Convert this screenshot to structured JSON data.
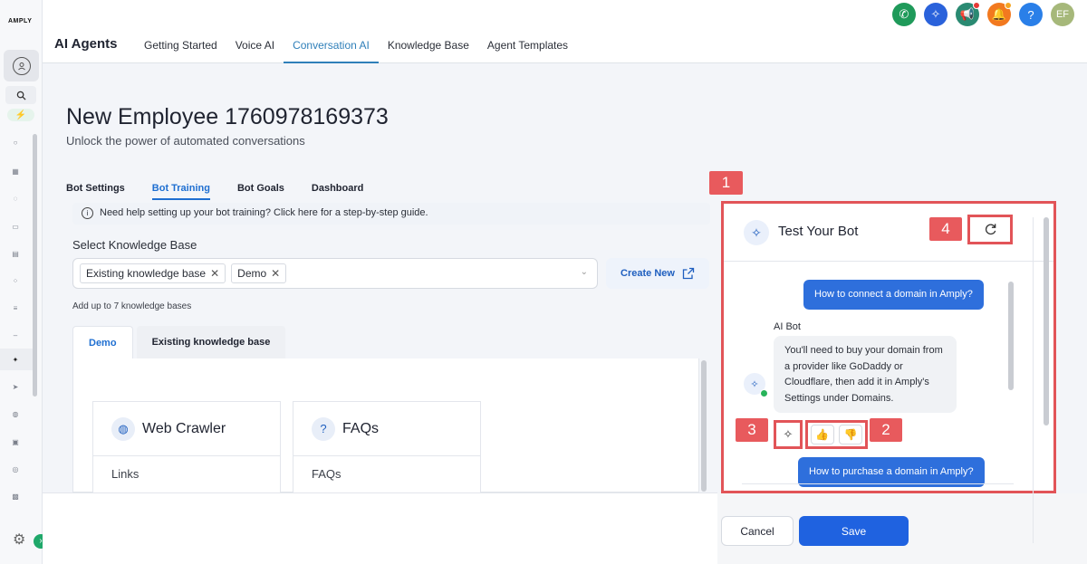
{
  "brand": "AMPLY",
  "header": {
    "app_title": "AI Agents",
    "tabs": [
      {
        "label": "Getting Started"
      },
      {
        "label": "Voice AI"
      },
      {
        "label": "Conversation AI"
      },
      {
        "label": "Knowledge Base"
      },
      {
        "label": "Agent Templates"
      }
    ],
    "active_tab": "Conversation AI",
    "icons": [
      {
        "name": "phone-icon",
        "color": "#1f9a5a"
      },
      {
        "name": "sparkle-icon",
        "color": "#2a62db"
      },
      {
        "name": "megaphone-icon",
        "color": "#2a8a72"
      },
      {
        "name": "bell-icon",
        "color": "#f2791f"
      },
      {
        "name": "help-icon",
        "color": "#2a7fe8"
      }
    ],
    "user_initials": "EF"
  },
  "page": {
    "title": "New Employee 1760978169373",
    "subtitle": "Unlock the power of automated conversations"
  },
  "subtabs": [
    {
      "label": "Bot Settings"
    },
    {
      "label": "Bot Training"
    },
    {
      "label": "Bot Goals"
    },
    {
      "label": "Dashboard"
    }
  ],
  "help_banner": "Need help setting up your bot training? Click here for a step-by-step guide.",
  "knowledge_base": {
    "label": "Select Knowledge Base",
    "chips": [
      "Existing knowledge base",
      "Demo"
    ],
    "create_label": "Create New",
    "hint": "Add up to 7 knowledge bases",
    "tabs": [
      "Demo",
      "Existing knowledge base"
    ],
    "cards": [
      {
        "title": "Web Crawler",
        "body": "Links"
      },
      {
        "title": "FAQs",
        "body": "FAQs"
      }
    ]
  },
  "bot_panel": {
    "title": "Test Your Bot",
    "messages": {
      "user_1": "How to connect a domain in Amply?",
      "ai_label": "AI Bot",
      "ai_1": "You'll need to buy your domain from a provider like GoDaddy or Cloudflare, then add it in Amply's Settings under Domains.",
      "user_2": "How to purchase a domain in Amply?"
    }
  },
  "badges": [
    "1",
    "2",
    "3",
    "4"
  ],
  "footer": {
    "cancel_label": "Cancel",
    "save_label": "Save"
  }
}
